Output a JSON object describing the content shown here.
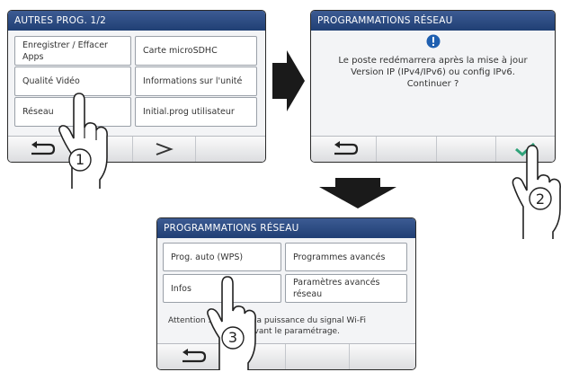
{
  "screen1": {
    "title": "AUTRES PROG. 1/2",
    "buttons": {
      "apps": "Enregistrer / Effacer Apps",
      "sd": "Carte microSDHC",
      "video": "Qualité Vidéo",
      "info": "Informations sur l'unité",
      "network": "Réseau",
      "init": "Initial.prog utilisateur"
    },
    "step": "1"
  },
  "screen2": {
    "title": "PROGRAMMATIONS RÉSEAU",
    "message": {
      "line1": "Le poste redémarrera après la mise à jour",
      "line2": "Version IP (IPv4/IPv6) ou config IPv6.",
      "line3": "Continuer ?"
    },
    "step": "2"
  },
  "screen3": {
    "title": "PROGRAMMATIONS RÉSEAU",
    "buttons": {
      "wps": "Prog. auto (WPS)",
      "advanced": "Programmes avancés",
      "infos": "Infos",
      "network_adv": "Paramètres avancés réseau"
    },
    "attention": {
      "line1_left": "Attention :",
      "line1_right": "la puissance du signal Wi-Fi",
      "line2": "avant le paramétrage."
    },
    "step": "3"
  },
  "colors": {
    "title_bar": "#2b4a80",
    "alert_icon": "#1f5fb0",
    "check": "#2fa37a",
    "arrow": "#1a1a1a"
  }
}
